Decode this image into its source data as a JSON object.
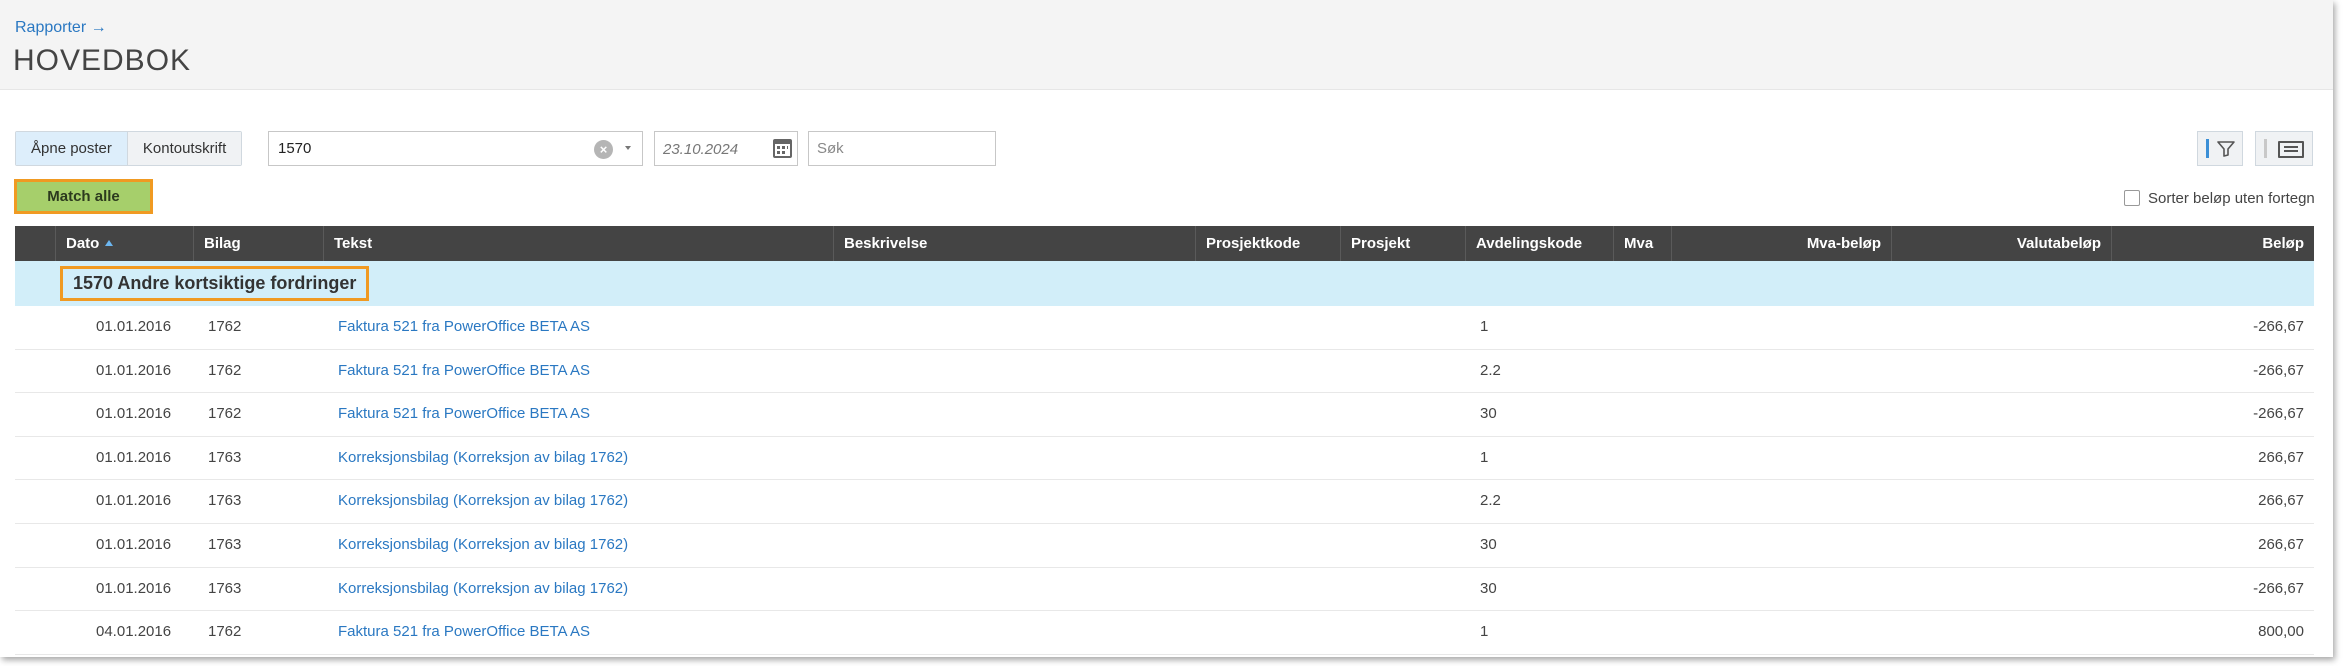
{
  "header": {
    "breadcrumb": "Rapporter →",
    "title": "HOVEDBOK"
  },
  "toolbar": {
    "tabs": [
      {
        "label": "Åpne poster",
        "active": true
      },
      {
        "label": "Kontoutskrift",
        "active": false
      }
    ],
    "account_value": "1570",
    "clear_icon": "×",
    "date_value": "23.10.2024",
    "search_placeholder": "Søk",
    "match_all_label": "Match alle",
    "sort_checkbox_label": "Sorter beløp uten fortegn"
  },
  "colors": {
    "accent": "#2a78c2",
    "header_bg": "#444444",
    "group_bg": "#d2eef9",
    "highlight": "#f09a22",
    "match_btn": "#a6cf6b"
  },
  "table": {
    "columns": {
      "dato": "Dato",
      "bilag": "Bilag",
      "tekst": "Tekst",
      "beskrivelse": "Beskrivelse",
      "prosjektkode": "Prosjektkode",
      "prosjekt": "Prosjekt",
      "avdelingskode": "Avdelingskode",
      "mva": "Mva",
      "mva_belop": "Mva-beløp",
      "valutabelop": "Valutabeløp",
      "belop": "Beløp"
    },
    "group_label": "1570 Andre kortsiktige fordringer",
    "rows": [
      {
        "dato": "01.01.2016",
        "bilag": "1762",
        "tekst": "Faktura 521 fra PowerOffice BETA AS",
        "avdeling": "1",
        "belop": "-266,67"
      },
      {
        "dato": "01.01.2016",
        "bilag": "1762",
        "tekst": "Faktura 521 fra PowerOffice BETA AS",
        "avdeling": "2.2",
        "belop": "-266,67"
      },
      {
        "dato": "01.01.2016",
        "bilag": "1762",
        "tekst": "Faktura 521 fra PowerOffice BETA AS",
        "avdeling": "30",
        "belop": "-266,67"
      },
      {
        "dato": "01.01.2016",
        "bilag": "1763",
        "tekst": "Korreksjonsbilag (Korreksjon av bilag 1762)",
        "avdeling": "1",
        "belop": "266,67"
      },
      {
        "dato": "01.01.2016",
        "bilag": "1763",
        "tekst": "Korreksjonsbilag (Korreksjon av bilag 1762)",
        "avdeling": "2.2",
        "belop": "266,67"
      },
      {
        "dato": "01.01.2016",
        "bilag": "1763",
        "tekst": "Korreksjonsbilag (Korreksjon av bilag 1762)",
        "avdeling": "30",
        "belop": "266,67"
      },
      {
        "dato": "01.01.2016",
        "bilag": "1763",
        "tekst": "Korreksjonsbilag (Korreksjon av bilag 1762)",
        "avdeling": "30",
        "belop": "-266,67"
      },
      {
        "dato": "04.01.2016",
        "bilag": "1762",
        "tekst": "Faktura 521 fra PowerOffice BETA AS",
        "avdeling": "1",
        "belop": "800,00"
      }
    ]
  }
}
